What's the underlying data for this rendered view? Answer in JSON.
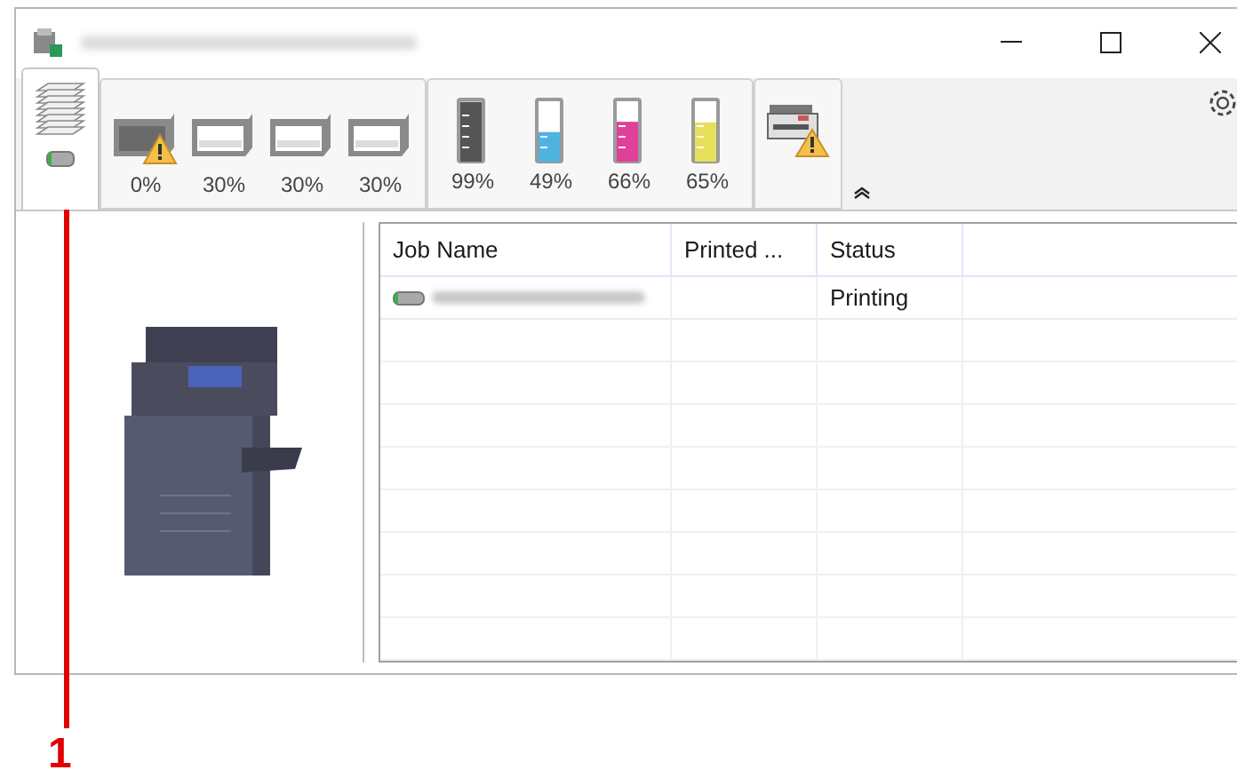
{
  "toolbar": {
    "tabs": [
      {
        "kind": "paper",
        "selected": true
      },
      {
        "kind": "trays",
        "selected": false,
        "items": [
          {
            "reading": "0%",
            "warning": true
          },
          {
            "reading": "30%",
            "warning": false
          },
          {
            "reading": "30%",
            "warning": false
          },
          {
            "reading": "30%",
            "warning": false
          }
        ]
      },
      {
        "kind": "toner",
        "selected": false,
        "items": [
          {
            "reading": "99%",
            "color": "#555555",
            "level": 0.99
          },
          {
            "reading": "49%",
            "color": "#4fb3e0",
            "level": 0.49
          },
          {
            "reading": "66%",
            "color": "#e0409a",
            "level": 0.66
          },
          {
            "reading": "65%",
            "color": "#e6e05a",
            "level": 0.65
          }
        ]
      },
      {
        "kind": "device",
        "selected": false,
        "warning": true
      }
    ]
  },
  "table": {
    "columns": [
      "Job Name",
      "Printed ...",
      "Status"
    ],
    "rows": [
      {
        "status": "Printing"
      }
    ]
  },
  "callout": {
    "label": "1"
  }
}
